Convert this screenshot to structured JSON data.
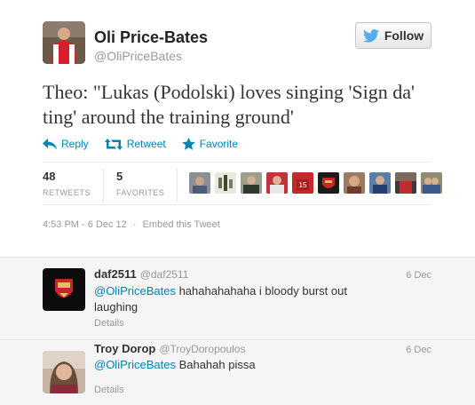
{
  "tweet": {
    "author": {
      "fullname": "Oli Price-Bates",
      "username": "@OliPriceBates"
    },
    "follow_label": "Follow",
    "text": "Theo: \"Lukas (Podolski) loves singing 'Sign da' ting' around the training ground'",
    "actions": {
      "reply": "Reply",
      "retweet": "Retweet",
      "favorite": "Favorite"
    },
    "stats": {
      "retweets": {
        "count": "48",
        "label": "RETWEETS"
      },
      "favorites": {
        "count": "5",
        "label": "FAVORITES"
      }
    },
    "meta": {
      "timestamp": "4:53 PM - 6 Dec 12",
      "separator": "·",
      "embed": "Embed this Tweet"
    }
  },
  "replies": [
    {
      "name": "daf2511",
      "handle": "@daf2511",
      "date": "6 Dec",
      "mention": "@OliPriceBates",
      "text": " hahahahahaha i bloody burst out laughing",
      "details": "Details"
    },
    {
      "name": "Troy Dorop",
      "handle": "@TroyDoropoulos",
      "date": "6 Dec",
      "mention": "@OliPriceBates",
      "text": " Bahahah pissa",
      "details": "Details"
    }
  ],
  "colors": {
    "link": "#0084b4",
    "twitter_bird": "#55acee",
    "muted": "#999999"
  },
  "icons": [
    "twitter-bird-icon",
    "reply-icon",
    "retweet-icon",
    "favorite-star-icon"
  ]
}
